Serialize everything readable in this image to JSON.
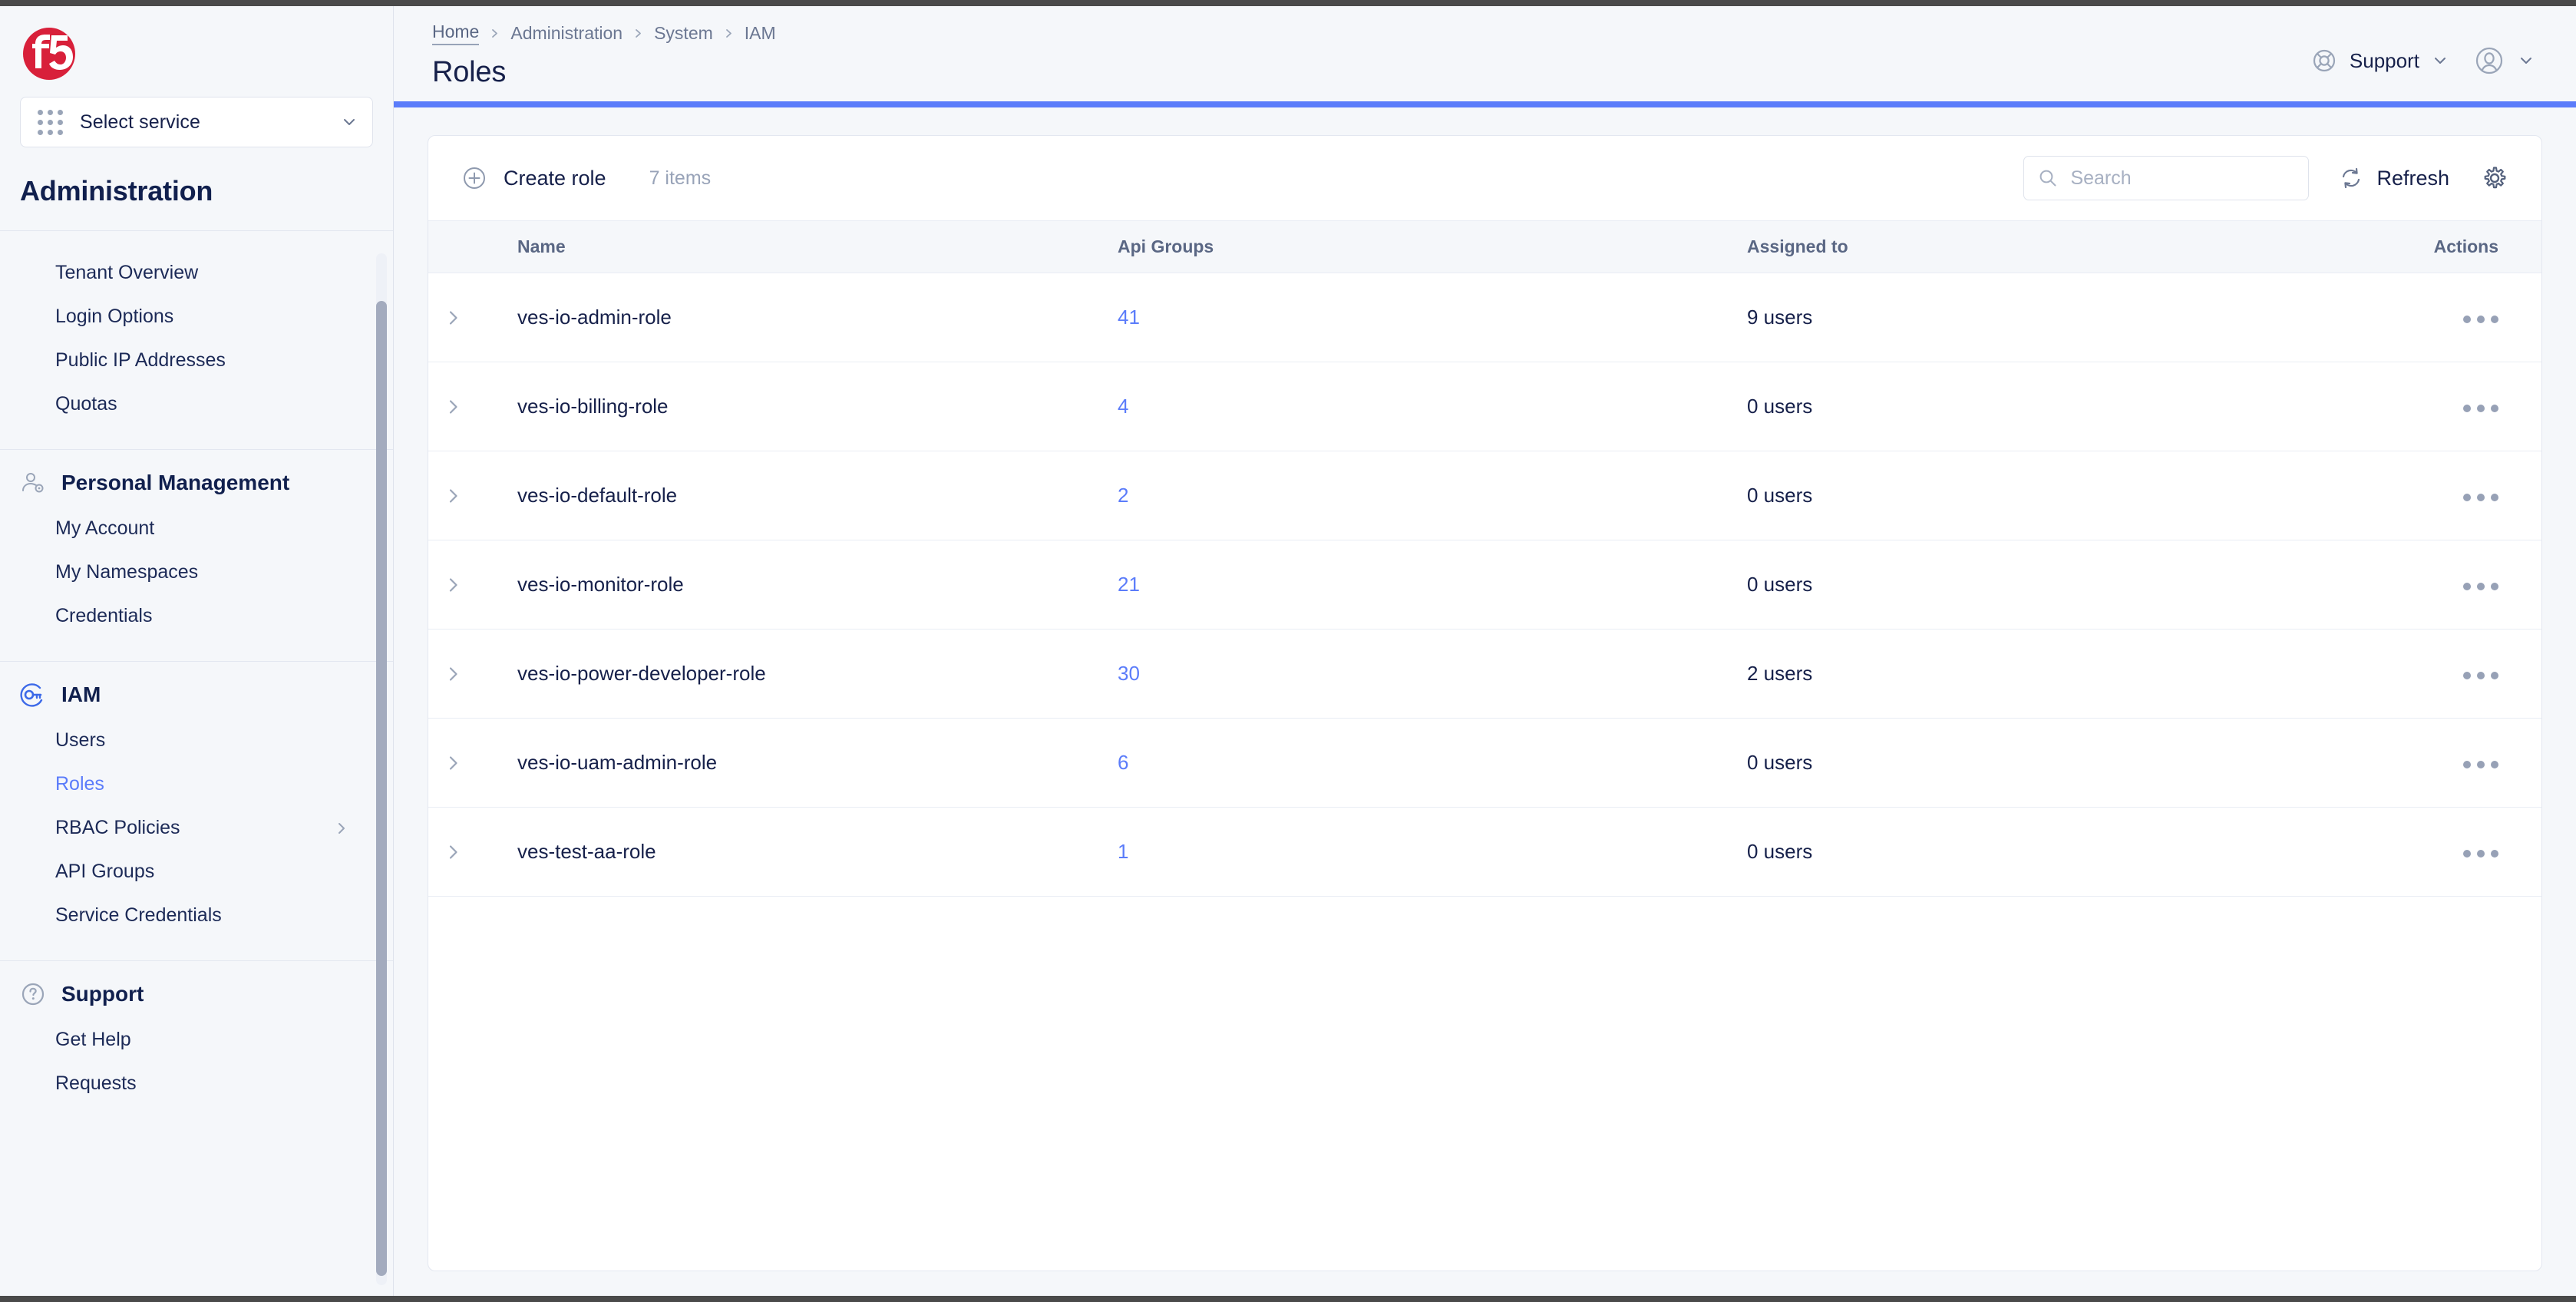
{
  "sidebar": {
    "logo_name": "f5-logo",
    "service_select": {
      "label": "Select service",
      "icon": "grid-icon"
    },
    "app_title": "Administration",
    "top_items": [
      {
        "label": "Tenant Overview"
      },
      {
        "label": "Login Options"
      },
      {
        "label": "Public IP Addresses"
      },
      {
        "label": "Quotas"
      }
    ],
    "groups": [
      {
        "label": "Personal Management",
        "icon": "user-gear-icon",
        "items": [
          {
            "label": "My Account"
          },
          {
            "label": "My Namespaces"
          },
          {
            "label": "Credentials"
          }
        ]
      },
      {
        "label": "IAM",
        "icon": "key-icon",
        "items": [
          {
            "label": "Users",
            "active": false
          },
          {
            "label": "Roles",
            "active": true
          },
          {
            "label": "RBAC Policies",
            "active": false,
            "has_submenu": true
          },
          {
            "label": "API Groups",
            "active": false
          },
          {
            "label": "Service Credentials",
            "active": false
          }
        ]
      },
      {
        "label": "Support",
        "icon": "help-circle-icon",
        "items": [
          {
            "label": "Get Help"
          },
          {
            "label": "Requests"
          }
        ]
      }
    ]
  },
  "header": {
    "breadcrumb": [
      "Home",
      "Administration",
      "System",
      "IAM"
    ],
    "title": "Roles",
    "support": {
      "label": "Support",
      "icon": "lifebuoy-icon"
    },
    "account": {
      "icon": "user-avatar-icon"
    },
    "accent_color": "#5b7cfa"
  },
  "toolbar": {
    "create_label": "Create role",
    "create_icon": "plus-circle-icon",
    "items_count": "7 items",
    "search": {
      "placeholder": "Search",
      "value": "",
      "icon": "search-icon"
    },
    "refresh_label": "Refresh",
    "refresh_icon": "refresh-icon",
    "settings_icon": "gear-icon"
  },
  "table": {
    "columns": [
      "Name",
      "Api Groups",
      "Assigned to",
      "Actions"
    ],
    "rows": [
      {
        "name": "ves-io-admin-role",
        "api_groups": "41",
        "assigned_to": "9 users"
      },
      {
        "name": "ves-io-billing-role",
        "api_groups": "4",
        "assigned_to": "0 users"
      },
      {
        "name": "ves-io-default-role",
        "api_groups": "2",
        "assigned_to": "0 users"
      },
      {
        "name": "ves-io-monitor-role",
        "api_groups": "21",
        "assigned_to": "0 users"
      },
      {
        "name": "ves-io-power-developer-role",
        "api_groups": "30",
        "assigned_to": "2 users"
      },
      {
        "name": "ves-io-uam-admin-role",
        "api_groups": "6",
        "assigned_to": "0 users"
      },
      {
        "name": "ves-test-aa-role",
        "api_groups": "1",
        "assigned_to": "0 users"
      }
    ]
  },
  "colors": {
    "link": "#5b7cfa",
    "accent": "#5b7cfa",
    "brand_red": "#d8203a",
    "text": "#16204a"
  }
}
